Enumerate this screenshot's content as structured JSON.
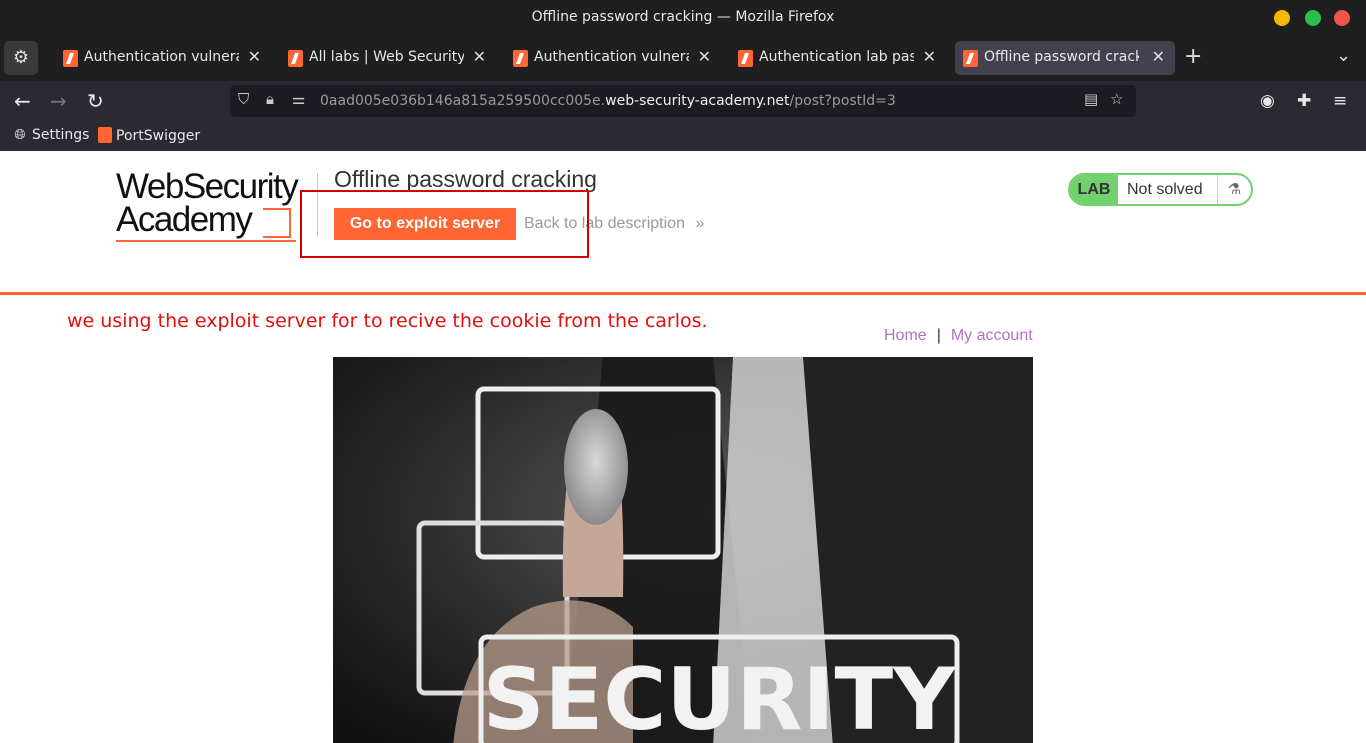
{
  "window": {
    "title": "Offline password cracking — Mozilla Firefox",
    "controls": {
      "minimize_color": "#f5b800",
      "maximize_color": "#2dbd4e",
      "close_color": "#f0544c"
    }
  },
  "tabs": [
    {
      "label": "Authentication vulnerabil"
    },
    {
      "label": "All labs | Web Security Ac"
    },
    {
      "label": "Authentication vulnerabil"
    },
    {
      "label": "Authentication lab passw"
    },
    {
      "label": "Offline password cracking"
    }
  ],
  "nav": {
    "url_prefix": "0aad005e036b146a815a259500cc005e.",
    "url_domain": "web-security-academy.net",
    "url_path": "/post?postId=3"
  },
  "bookmarks": [
    {
      "label": "Settings",
      "icon": "globe-icon"
    },
    {
      "label": "PortSwigger",
      "icon": "portswigger-icon"
    }
  ],
  "page": {
    "logo_line1": "WebSecurity",
    "logo_line2": "Academy",
    "lab_title": "Offline password cracking",
    "exploit_button": "Go to exploit server",
    "back_link": "Back to lab description",
    "back_chevron": "»",
    "lab_badge": "LAB",
    "lab_status": "Not solved",
    "annotation_note": "we using the exploit server for to recive the cookie from the carlos.",
    "nav_home": "Home",
    "nav_separator": "|",
    "nav_account": "My account",
    "hero_text": "SECURITY",
    "accent_color": "#ff6633"
  }
}
